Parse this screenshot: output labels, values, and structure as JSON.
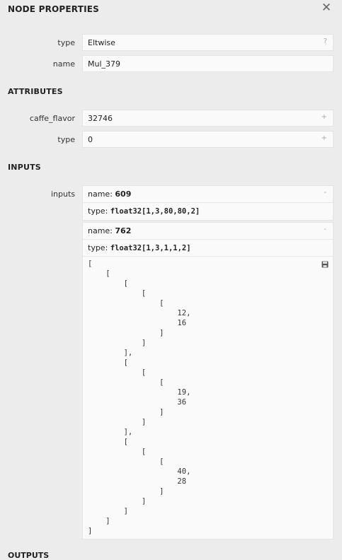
{
  "header": {
    "title": "NODE PROPERTIES",
    "close_icon": "close-icon"
  },
  "properties": [
    {
      "label": "type",
      "value": "Eltwise",
      "icon": "?"
    },
    {
      "label": "name",
      "value": "Mul_379",
      "icon": ""
    }
  ],
  "attributes_title": "ATTRIBUTES",
  "attributes": [
    {
      "label": "caffe_flavor",
      "value": "32746",
      "icon": "+"
    },
    {
      "label": "type",
      "value": "0",
      "icon": "+"
    }
  ],
  "inputs_title": "INPUTS",
  "inputs_label": "inputs",
  "inputs": [
    {
      "name_label": "name:",
      "name": "609",
      "type_label": "type:",
      "type": "float32[1,3,80,80,2]",
      "toggle": "-"
    },
    {
      "name_label": "name:",
      "name": "762",
      "type_label": "type:",
      "type": "float32[1,3,1,1,2]",
      "toggle": "-",
      "tensor_lines": [
        "[",
        "    [",
        "        [",
        "            [",
        "                [",
        "                    12,",
        "                    16",
        "                ]",
        "            ]",
        "        ],",
        "        [",
        "            [",
        "                [",
        "                    19,",
        "                    36",
        "                ]",
        "            ]",
        "        ],",
        "        [",
        "            [",
        "                [",
        "                    40,",
        "                    28",
        "                ]",
        "            ]",
        "        ]",
        "    ]",
        "]"
      ]
    }
  ],
  "outputs_title": "OUTPUTS"
}
